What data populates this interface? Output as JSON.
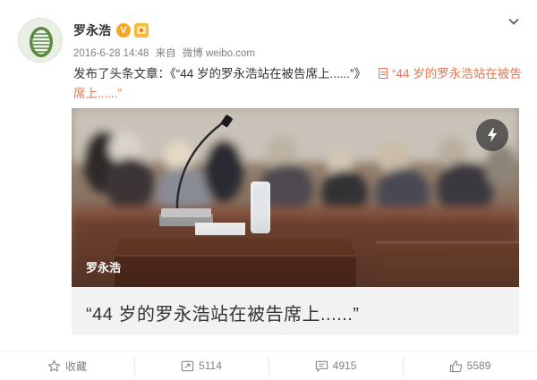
{
  "post": {
    "author": "罗永浩",
    "verified_badge": "V",
    "timestamp": "2016-6-28 14:48",
    "source_prefix": "来自",
    "source": "微博 weibo.com",
    "text_prefix": "发布了头条文章：《“44 岁的罗永浩站在被告席上......”》",
    "article_link": "“44 岁的罗永浩站在被告席上......”"
  },
  "card": {
    "author": "罗永浩",
    "title": "“44 岁的罗永浩站在被告席上......”",
    "image_icon": "lightning-icon"
  },
  "actions": {
    "favorite": "收藏",
    "repost": "5114",
    "comment": "4915",
    "like": "5589"
  },
  "colors": {
    "link": "#eb7350",
    "badge": "#f6a623",
    "muted": "#808080"
  }
}
